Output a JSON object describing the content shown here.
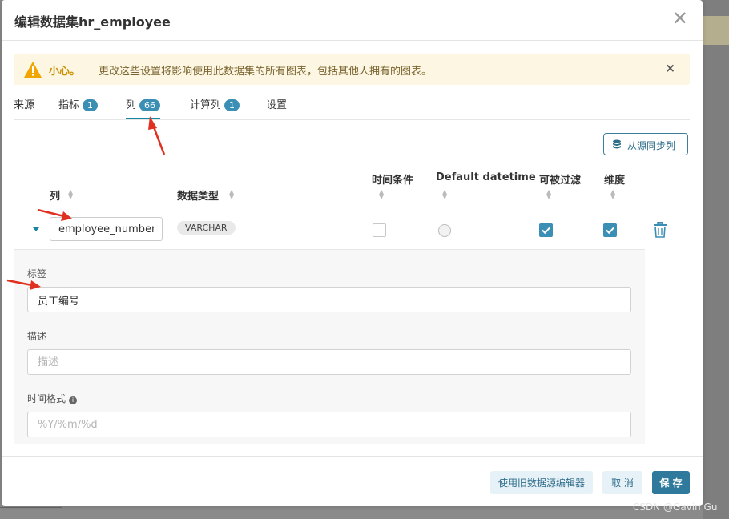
{
  "background": {
    "edge_text": "e"
  },
  "modal": {
    "title": "编辑数据集hr_employee",
    "close_label": "✕"
  },
  "alert": {
    "strong": "小心。",
    "message": "更改这些设置将影响使用此数据集的所有图表，包括其他人拥有的图表。",
    "close": "×"
  },
  "tabs": [
    {
      "label": "来源"
    },
    {
      "label": "指标",
      "badge": "1"
    },
    {
      "label": "列",
      "badge": "66"
    },
    {
      "label": "计算列",
      "badge": "1"
    },
    {
      "label": "设置"
    }
  ],
  "sync_button": {
    "label": "从源同步列"
  },
  "columns_header": {
    "column": "列",
    "data_type": "数据类型",
    "is_temporal": "时间条件",
    "default_datetime": "Default datetime",
    "filterable": "可被过滤",
    "dimension": "维度"
  },
  "row": {
    "column_name": "employee_number",
    "type": "VARCHAR",
    "is_temporal": false,
    "default_datetime": false,
    "filterable": true,
    "dimension": true
  },
  "detail": {
    "label_title": "标签",
    "label_value": "员工编号",
    "description_title": "描述",
    "description_placeholder": "描述",
    "datetime_format_title": "时间格式",
    "datetime_format_placeholder": "%Y/%m/%d"
  },
  "footer": {
    "legacy_button": "使用旧数据源编辑器",
    "cancel_button": "取 消",
    "save_button": "保 存"
  },
  "colors": {
    "accent": "#1a85a0",
    "primary": "#2f7a9c",
    "badge": "#3b8fb5",
    "warning_bg": "#fcf6e2",
    "warning_icon": "#f0a500",
    "annotation_arrow": "#e03020"
  },
  "watermark": "CSDN @Gavin Gu"
}
